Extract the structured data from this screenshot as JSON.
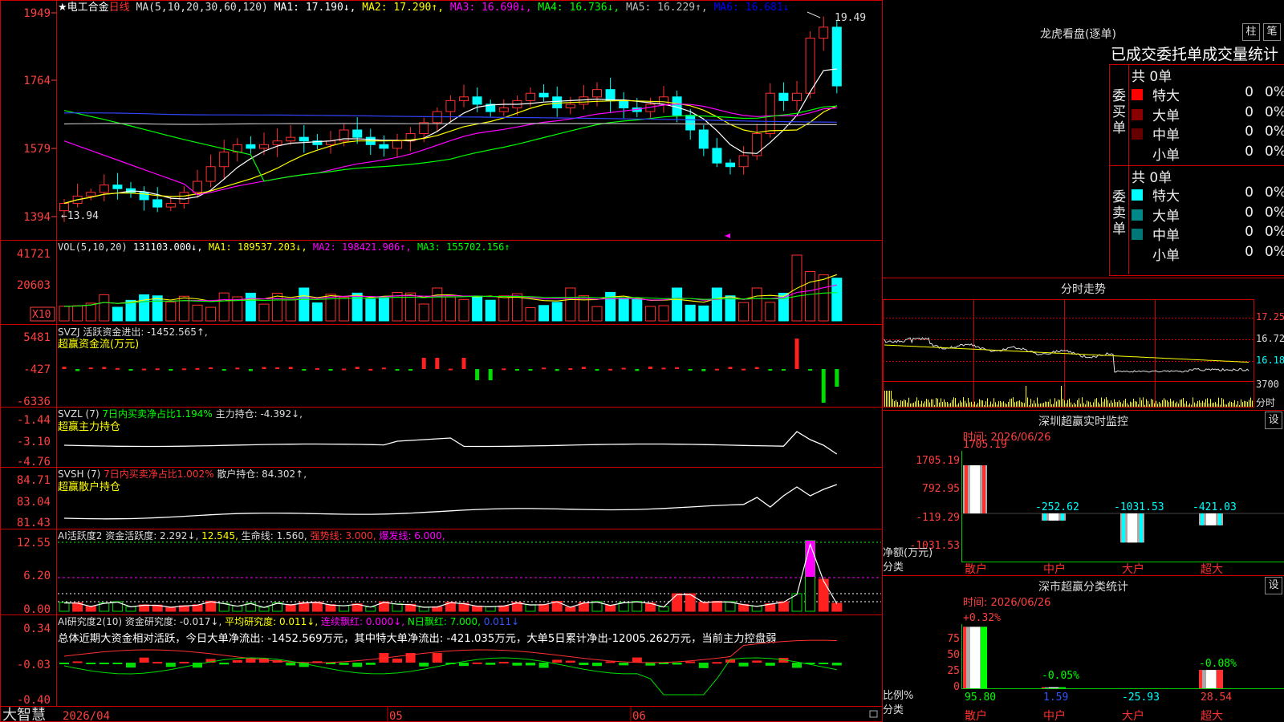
{
  "left_panel": {
    "stock_name": "★电工合金",
    "period": "日线",
    "price_axis": [
      "1949",
      "1764",
      "1579",
      "1394"
    ],
    "price_ma_header": [
      {
        "text": "MA(5,10,20,30,60,120)",
        "color": "#dddddd"
      },
      {
        "text": "MA1: 17.190↓,",
        "color": "#ffffff"
      },
      {
        "text": "MA2: 17.290↑,",
        "color": "#ffff00"
      },
      {
        "text": "MA3: 16.690↓,",
        "color": "#ff00ff"
      },
      {
        "text": "MA4: 16.736↓,",
        "color": "#00ff00"
      },
      {
        "text": "MA5: 16.229↑,",
        "color": "#bbbbbb"
      },
      {
        "text": "MA6: 16.681↓",
        "color": "#0000ff"
      }
    ],
    "high_label": "19.49",
    "low_label": "←13.94",
    "vol": {
      "axis": [
        "41721",
        "20603",
        "X10"
      ],
      "header": [
        {
          "text": "VOL(5,10,20)",
          "color": "#dddddd"
        },
        {
          "text": "131103.000↓,",
          "color": "#ffffff"
        },
        {
          "text": "MA1: 189537.203↓,",
          "color": "#ffff00"
        },
        {
          "text": "MA2: 198421.906↑,",
          "color": "#ff00ff"
        },
        {
          "text": "MA3: 155702.156↑",
          "color": "#00ff00"
        }
      ]
    },
    "svzj": {
      "axis": [
        "5481",
        "-427",
        "-6336"
      ],
      "header": [
        {
          "text": "SVZJ  活跃资金进出: -1452.565↑,",
          "color": "#dddddd"
        }
      ],
      "subtitle": "超赢资金流(万元)"
    },
    "svzl": {
      "axis": [
        "-1.44",
        "-3.10",
        "-4.76"
      ],
      "header": [
        {
          "text": "SVZL (7)",
          "color": "#dddddd"
        },
        {
          "text": "7日内买卖净占比1.194%",
          "color": "#00ff00"
        },
        {
          "text": "主力持仓: -4.392↓,",
          "color": "#dddddd"
        }
      ],
      "subtitle": "超赢主力持仓"
    },
    "svsh": {
      "axis": [
        "84.71",
        "83.04",
        "81.43"
      ],
      "header": [
        {
          "text": "SVSH (7)",
          "color": "#dddddd"
        },
        {
          "text": "7日内买卖净占比1.002%",
          "color": "#ff3333"
        },
        {
          "text": "散户持仓: 84.302↑,",
          "color": "#dddddd"
        }
      ],
      "subtitle": "超赢散户持仓"
    },
    "ai1": {
      "axis": [
        "12.55",
        "6.20",
        "0.00"
      ],
      "header": [
        {
          "text": "AI活跃度2 资金活跃度: 2.292↓,",
          "color": "#dddddd"
        },
        {
          "text": "12.545,",
          "color": "#ffff00"
        },
        {
          "text": "生命线: 1.560,",
          "color": "#dddddd"
        },
        {
          "text": "强势线: 3.000,",
          "color": "#ff3333"
        },
        {
          "text": "爆发线: 6.000,",
          "color": "#ff00ff"
        }
      ]
    },
    "ai2": {
      "axis": [
        "0.34",
        "-0.03",
        "-0.40"
      ],
      "header": [
        {
          "text": "AI研究度2(10)",
          "color": "#dddddd"
        },
        {
          "text": "资金研究度: -0.017↓,",
          "color": "#dddddd"
        },
        {
          "text": "平均研究度: 0.011↓,",
          "color": "#ffff00"
        },
        {
          "text": "连续飘红: 0.000↓,",
          "color": "#ff00ff"
        },
        {
          "text": "N日飘红: 7.000,",
          "color": "#00ff00"
        },
        {
          "text": "0.011↓",
          "color": "#3355ff"
        }
      ],
      "summary": "总体近期大资金相对活跃，今日大单净流出: -1452.569万元，其中特大单净流出: -421.035万元，大单5日累计净出-12005.262万元，当前主力控盘弱"
    },
    "footer": {
      "brand": "大智慧",
      "dates": [
        "2026/04",
        "05",
        "06"
      ]
    }
  },
  "longhu": {
    "title": "龙虎看盘(逐单)",
    "tabs": [
      "柱",
      "笔"
    ],
    "subtitle": "已成交委托单成交量统计",
    "buy": {
      "label": "委买单",
      "total": "共 0单",
      "rows": [
        {
          "name": "特大",
          "count": "0",
          "pct": "0%",
          "color": "#ff0000"
        },
        {
          "name": "大单",
          "count": "0",
          "pct": "0%",
          "color": "#880000"
        },
        {
          "name": "中单",
          "count": "0",
          "pct": "0%",
          "color": "#660000"
        },
        {
          "name": "小单",
          "count": "0",
          "pct": "0%",
          "color": "#000000"
        }
      ]
    },
    "sell": {
      "label": "委卖单",
      "total": "共 0单",
      "rows": [
        {
          "name": "特大",
          "count": "0",
          "pct": "0%",
          "color": "#00ffff"
        },
        {
          "name": "大单",
          "count": "0",
          "pct": "0%",
          "color": "#008888"
        },
        {
          "name": "中单",
          "count": "0",
          "pct": "0%",
          "color": "#007777"
        },
        {
          "name": "小单",
          "count": "0",
          "pct": "0%",
          "color": "#000000"
        }
      ]
    }
  },
  "intraday": {
    "title": "分时走势",
    "axis": [
      "17.25",
      "16.72",
      "16.18",
      "3700",
      "分时"
    ]
  },
  "sz_monitor": {
    "title": "深圳超赢实时监控",
    "settings": "设",
    "time_label": "时间: 2026/06/26",
    "axis": [
      "1705.19",
      "792.95",
      "-119.29",
      "-1031.53"
    ],
    "ylabel": "净额(万元)",
    "xlabel": "分类",
    "categories": [
      "散户",
      "中户",
      "大户",
      "超大"
    ],
    "value_labels": [
      "1705.19",
      "-252.62",
      "-1031.53",
      "-421.03"
    ]
  },
  "sz_stat": {
    "title": "深市超赢分类统计",
    "settings": "设",
    "time_label": "时间: 2026/06/26",
    "axis": [
      "75",
      "50",
      "25",
      "0"
    ],
    "ylabel": "比例%",
    "xlabel": "分类",
    "categories": [
      "散户",
      "中户",
      "大户",
      "超大"
    ],
    "top_labels": [
      "+0.32%",
      "-0.05%",
      "",
      "-0.08%"
    ],
    "bottom_labels": [
      "95.80",
      "1.59",
      "-25.93",
      "28.54"
    ]
  },
  "chart_data": [
    {
      "type": "candlestick",
      "title": "电工合金 日线",
      "ylim": [
        13.94,
        19.49
      ],
      "x": [
        "2026/04",
        "05",
        "06"
      ],
      "annotations": {
        "high": 19.49,
        "low": 13.94
      },
      "series": [
        {
          "name": "MA1",
          "last": 17.19
        },
        {
          "name": "MA2",
          "last": 17.29
        },
        {
          "name": "MA3",
          "last": 16.69
        },
        {
          "name": "MA4",
          "last": 16.736
        },
        {
          "name": "MA5",
          "last": 16.229
        },
        {
          "name": "MA6",
          "last": 16.681
        }
      ]
    },
    {
      "type": "bar",
      "title": "深圳超赢实时监控",
      "categories": [
        "散户",
        "中户",
        "大户",
        "超大"
      ],
      "values": [
        1705.19,
        -252.62,
        -1031.53,
        -421.03
      ],
      "ylabel": "净额(万元)",
      "xlabel": "分类",
      "ylim": [
        -1031.53,
        1705.19
      ]
    },
    {
      "type": "bar",
      "title": "深市超赢分类统计",
      "categories": [
        "散户",
        "中户",
        "大户",
        "超大"
      ],
      "values": [
        95.8,
        1.59,
        -25.93,
        28.54
      ],
      "ylabel": "比例%",
      "xlabel": "分类",
      "ylim": [
        0,
        75
      ]
    }
  ]
}
